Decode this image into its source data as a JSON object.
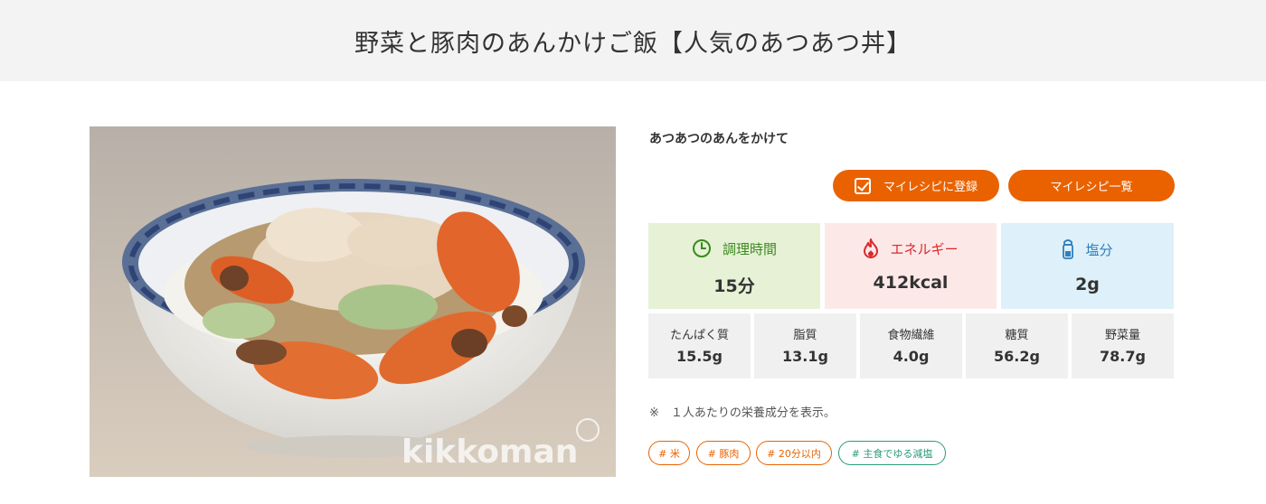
{
  "header": {
    "title": "野菜と豚肉のあんかけご飯【人気のあつあつ丼】"
  },
  "photo": {
    "watermark": "kikkoman"
  },
  "recipe": {
    "subtitle": "あつあつのあんをかけて"
  },
  "actions": {
    "register_label": "マイレシピに登録",
    "list_label": "マイレシピ一覧"
  },
  "stats": [
    {
      "label": "調理時間",
      "value": "15分",
      "icon": "clock-icon",
      "color": "#3a8a1e"
    },
    {
      "label": "エネルギー",
      "value": "412kcal",
      "icon": "flame-icon",
      "color": "#d92a2a"
    },
    {
      "label": "塩分",
      "value": "2g",
      "icon": "salt-shaker-icon",
      "color": "#2d7fbf"
    }
  ],
  "nutrition": [
    {
      "label": "たんぱく質",
      "value": "15.5g"
    },
    {
      "label": "脂質",
      "value": "13.1g"
    },
    {
      "label": "食物繊維",
      "value": "4.0g"
    },
    {
      "label": "糖質",
      "value": "56.2g"
    },
    {
      "label": "野菜量",
      "value": "78.7g"
    }
  ],
  "note": "※　１人あたりの栄養成分を表示。",
  "tags": [
    {
      "label": "# 米",
      "color": "#ea6200"
    },
    {
      "label": "# 豚肉",
      "color": "#ea6200"
    },
    {
      "label": "# 20分以内",
      "color": "#ea6200"
    },
    {
      "label": "# 主食でゆる減塩",
      "color": "#2a9a7a"
    }
  ],
  "accent_color": "#ea6200"
}
